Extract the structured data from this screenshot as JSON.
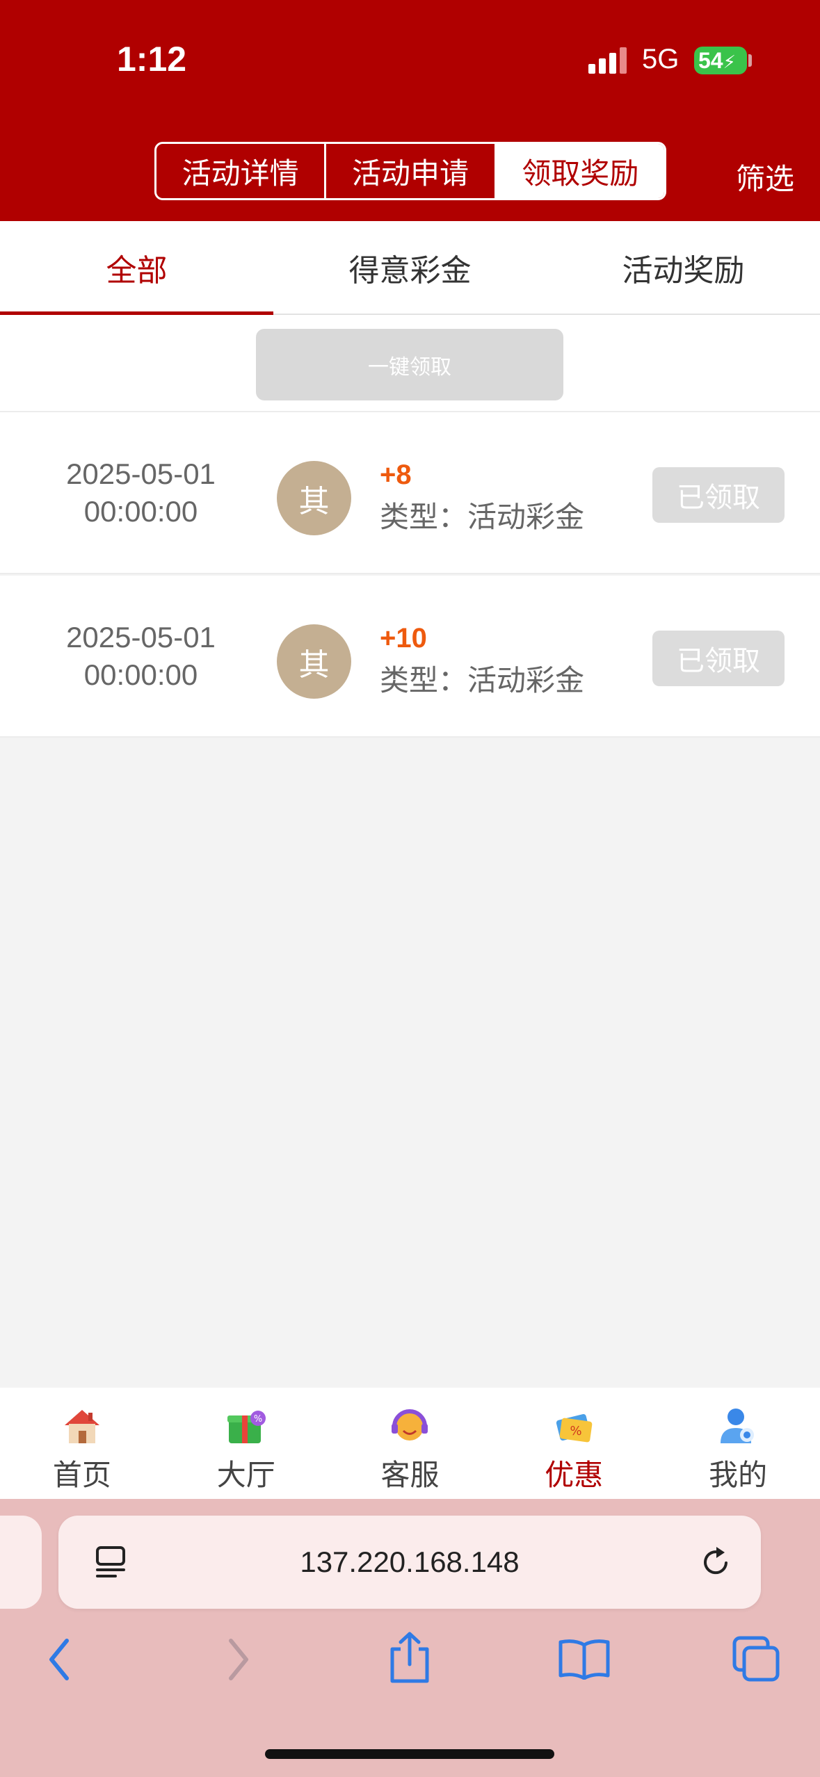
{
  "status_bar": {
    "time": "1:12",
    "network": "5G",
    "battery": "54"
  },
  "header": {
    "segments": [
      {
        "label": "活动详情",
        "active": false
      },
      {
        "label": "活动申请",
        "active": false
      },
      {
        "label": "领取奖励",
        "active": true
      }
    ],
    "filter_label": "筛选"
  },
  "tabs": [
    {
      "label": "全部",
      "active": true
    },
    {
      "label": "得意彩金",
      "active": false
    },
    {
      "label": "活动奖励",
      "active": false
    }
  ],
  "claim_all_label": "一键领取",
  "records": [
    {
      "date": "2025-05-01",
      "time": "00:00:00",
      "avatar_char": "其",
      "amount": "+8",
      "type": "类型：活动彩金",
      "status": "已领取"
    },
    {
      "date": "2025-05-01",
      "time": "00:00:00",
      "avatar_char": "其",
      "amount": "+10",
      "type": "类型：活动彩金",
      "status": "已领取"
    }
  ],
  "bottom_nav": [
    {
      "label": "首页",
      "icon": "house-icon",
      "active": false
    },
    {
      "label": "大厅",
      "icon": "gift-box-icon",
      "active": false
    },
    {
      "label": "客服",
      "icon": "headset-emoji-icon",
      "active": false
    },
    {
      "label": "优惠",
      "icon": "discount-ticket-icon",
      "active": true
    },
    {
      "label": "我的",
      "icon": "user-profile-icon",
      "active": false
    }
  ],
  "browser": {
    "url": "137.220.168.148"
  },
  "colors": {
    "brand": "#b00000",
    "amount": "#ee5a0e",
    "avatar": "#c4af92",
    "battery": "#3ac34a",
    "browser_bar": "#e8bcbc"
  }
}
